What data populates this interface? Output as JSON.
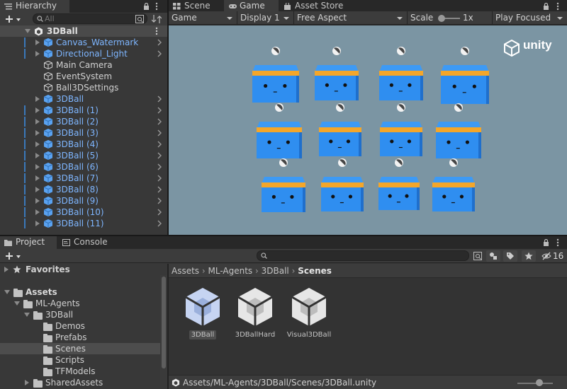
{
  "hierarchy": {
    "tab_label": "Hierarchy",
    "search_placeholder": "All",
    "scene_name": "3DBall",
    "items": [
      {
        "label": "Canvas_Watermark",
        "blue": true,
        "arrow": true,
        "chevron": true,
        "bar": true
      },
      {
        "label": "Directional_Light",
        "blue": true,
        "arrow": true,
        "chevron": true,
        "bar": true
      },
      {
        "label": "Main Camera",
        "blue": false,
        "arrow": false,
        "chevron": false,
        "bar": false
      },
      {
        "label": "EventSystem",
        "blue": false,
        "arrow": false,
        "chevron": false,
        "bar": false
      },
      {
        "label": "Ball3DSettings",
        "blue": false,
        "arrow": false,
        "chevron": false,
        "bar": false
      },
      {
        "label": "3DBall",
        "blue": true,
        "arrow": true,
        "chevron": true,
        "bar": false
      },
      {
        "label": "3DBall (1)",
        "blue": true,
        "arrow": true,
        "chevron": true,
        "bar": true
      },
      {
        "label": "3DBall (2)",
        "blue": true,
        "arrow": true,
        "chevron": true,
        "bar": true
      },
      {
        "label": "3DBall (3)",
        "blue": true,
        "arrow": true,
        "chevron": true,
        "bar": true
      },
      {
        "label": "3DBall (4)",
        "blue": true,
        "arrow": true,
        "chevron": true,
        "bar": true
      },
      {
        "label": "3DBall (5)",
        "blue": true,
        "arrow": true,
        "chevron": true,
        "bar": true
      },
      {
        "label": "3DBall (6)",
        "blue": true,
        "arrow": true,
        "chevron": true,
        "bar": true
      },
      {
        "label": "3DBall (7)",
        "blue": true,
        "arrow": true,
        "chevron": true,
        "bar": true
      },
      {
        "label": "3DBall (8)",
        "blue": true,
        "arrow": true,
        "chevron": true,
        "bar": true
      },
      {
        "label": "3DBall (9)",
        "blue": true,
        "arrow": true,
        "chevron": true,
        "bar": true
      },
      {
        "label": "3DBall (10)",
        "blue": true,
        "arrow": true,
        "chevron": true,
        "bar": true
      },
      {
        "label": "3DBall (11)",
        "blue": true,
        "arrow": true,
        "chevron": true,
        "bar": true
      }
    ]
  },
  "top_tabs": {
    "scene": "Scene",
    "game": "Game",
    "asset_store": "Asset Store"
  },
  "game_toolbar": {
    "view": "Game",
    "display": "Display 1",
    "aspect": "Free Aspect",
    "scale_label": "Scale",
    "scale_value": "1x",
    "play_mode": "Play Focused"
  },
  "game_view": {
    "logo_text": "unity",
    "background": "#7b95a3",
    "cube_color": "#2f8ef0",
    "band_color": "#f4a62a"
  },
  "bottom_tabs": {
    "project": "Project",
    "console": "Console"
  },
  "project": {
    "hidden_count": "16",
    "favorites": "Favorites",
    "tree": [
      {
        "label": "Assets",
        "depth": 0,
        "expanded": true,
        "bold": true,
        "selected": false
      },
      {
        "label": "ML-Agents",
        "depth": 1,
        "expanded": true,
        "bold": false,
        "selected": false
      },
      {
        "label": "3DBall",
        "depth": 2,
        "expanded": true,
        "bold": false,
        "selected": false
      },
      {
        "label": "Demos",
        "depth": 3,
        "expanded": null,
        "bold": false,
        "selected": false
      },
      {
        "label": "Prefabs",
        "depth": 3,
        "expanded": null,
        "bold": false,
        "selected": false
      },
      {
        "label": "Scenes",
        "depth": 3,
        "expanded": null,
        "bold": false,
        "selected": true
      },
      {
        "label": "Scripts",
        "depth": 3,
        "expanded": null,
        "bold": false,
        "selected": false
      },
      {
        "label": "TFModels",
        "depth": 3,
        "expanded": null,
        "bold": false,
        "selected": false
      },
      {
        "label": "SharedAssets",
        "depth": 2,
        "expanded": false,
        "bold": false,
        "selected": false
      }
    ],
    "breadcrumb": [
      "Assets",
      "ML-Agents",
      "3DBall",
      "Scenes"
    ],
    "assets": [
      {
        "label": "3DBall",
        "selected": true
      },
      {
        "label": "3DBallHard",
        "selected": false
      },
      {
        "label": "Visual3DBall",
        "selected": false
      }
    ],
    "status_path": "Assets/ML-Agents/3DBall/Scenes/3DBall.unity"
  }
}
